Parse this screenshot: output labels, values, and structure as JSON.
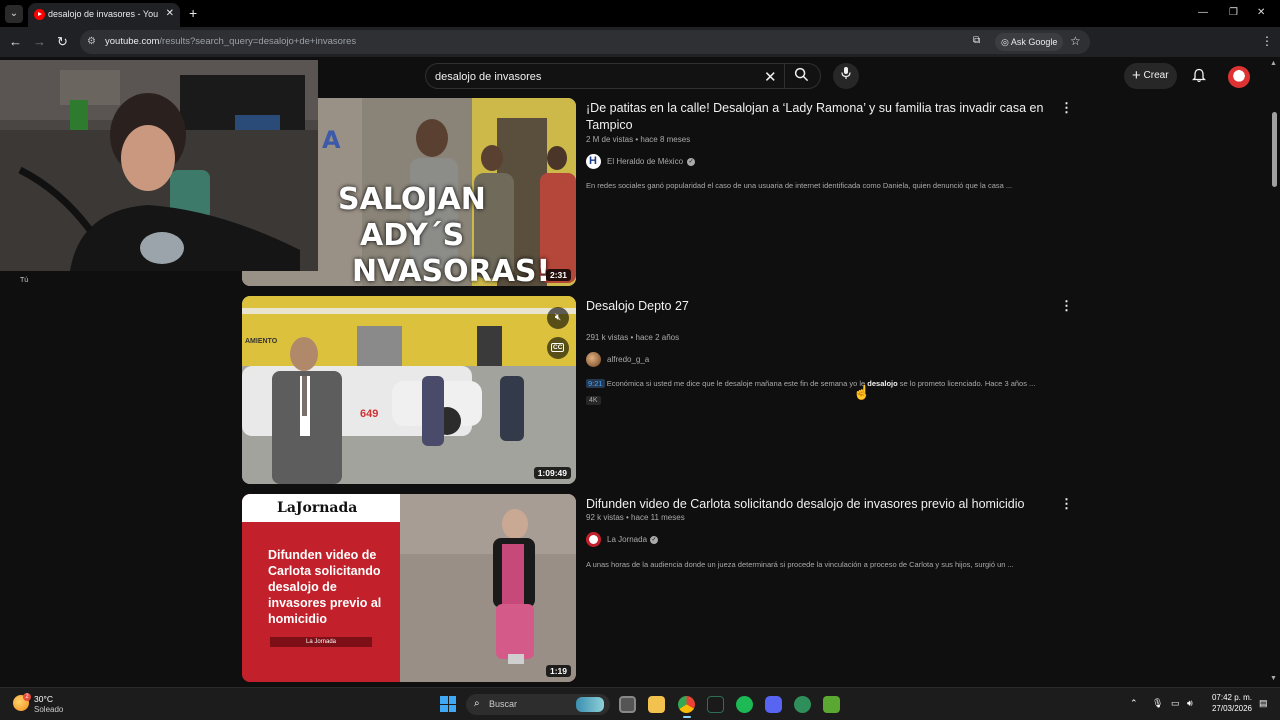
{
  "browser": {
    "tab_title": "desalojo de invasores - YouTube",
    "url_host": "youtube.com",
    "url_path": "/results?search_query=desalojo+de+invasores",
    "ask_google": "Ask Google",
    "profile_initial": "M"
  },
  "youtube": {
    "search_query": "desalojo de invasores",
    "create_label": "Crear",
    "videos": [
      {
        "title": "¡De patitas en la calle! Desalojan a ‘Lady Ramona’ y su familia tras invadir casa en Tampico",
        "views": "2 M de vistas",
        "age": "hace 8 meses",
        "channel": "El Heraldo de México",
        "verified": true,
        "description": "En redes sociales ganó popularidad el caso de una usuaria de internet identificada como Daniela, quien denunció que la casa ...",
        "duration": "2:31",
        "thumb_text_lines": [
          "SALOJAN",
          "ADY´S",
          "NVASORAS!"
        ],
        "thumb_sign": "A"
      },
      {
        "title": "Desalojo Depto 27",
        "views": "291 k vistas",
        "age": "hace 2 años",
        "channel": "alfredo_g_a",
        "verified": false,
        "timestamp_chip": "9:21",
        "description_before": "Económica si usted me dice que le desaloje mañana este fin de semana yo le ",
        "description_bold": "desalojo",
        "description_after": " se lo prometo licenciado. Hace 3 años ...",
        "badge": "4K",
        "duration": "1:09:49",
        "thumb_car_number": "649",
        "thumb_sign": "AMIENTO",
        "cc_label": "CC"
      },
      {
        "title": "Difunden video de Carlota solicitando desalojo de invasores previo al homicidio",
        "views": "92 k vistas",
        "age": "hace 11 meses",
        "channel": "La Jornada",
        "verified": true,
        "description": "A unas horas de la audiencia donde un jueza determinará si procede la vinculación a proceso de Carlota y sus hijos, surgió un ...",
        "duration": "1:19",
        "thumb_logo": "LaJornada",
        "thumb_headline": "Difunden video de Carlota solicitando desalojo de invasores previo al homicidio",
        "thumb_footer": "La Jornada"
      }
    ]
  },
  "webcam": {
    "label": "Tú"
  },
  "taskbar": {
    "temperature": "30°C",
    "condition": "Soleado",
    "weather_badge": "2",
    "search_placeholder": "Buscar",
    "time": "07:42 p. m.",
    "date": "27/03/2026"
  }
}
